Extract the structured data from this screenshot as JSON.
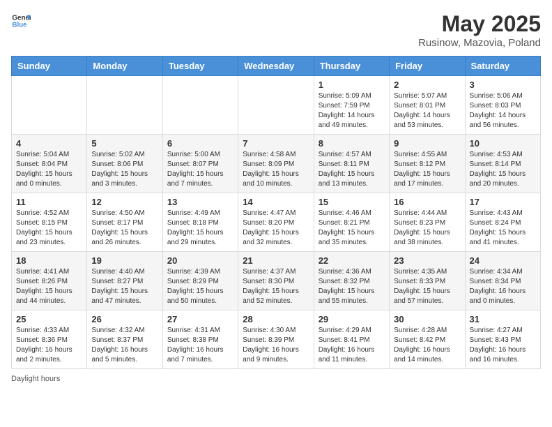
{
  "header": {
    "logo_general": "General",
    "logo_blue": "Blue",
    "title": "May 2025",
    "subtitle": "Rusinow, Mazovia, Poland"
  },
  "days_of_week": [
    "Sunday",
    "Monday",
    "Tuesday",
    "Wednesday",
    "Thursday",
    "Friday",
    "Saturday"
  ],
  "weeks": [
    [
      {
        "day": "",
        "info": ""
      },
      {
        "day": "",
        "info": ""
      },
      {
        "day": "",
        "info": ""
      },
      {
        "day": "",
        "info": ""
      },
      {
        "day": "1",
        "info": "Sunrise: 5:09 AM\nSunset: 7:59 PM\nDaylight: 14 hours\nand 49 minutes."
      },
      {
        "day": "2",
        "info": "Sunrise: 5:07 AM\nSunset: 8:01 PM\nDaylight: 14 hours\nand 53 minutes."
      },
      {
        "day": "3",
        "info": "Sunrise: 5:06 AM\nSunset: 8:03 PM\nDaylight: 14 hours\nand 56 minutes."
      }
    ],
    [
      {
        "day": "4",
        "info": "Sunrise: 5:04 AM\nSunset: 8:04 PM\nDaylight: 15 hours\nand 0 minutes."
      },
      {
        "day": "5",
        "info": "Sunrise: 5:02 AM\nSunset: 8:06 PM\nDaylight: 15 hours\nand 3 minutes."
      },
      {
        "day": "6",
        "info": "Sunrise: 5:00 AM\nSunset: 8:07 PM\nDaylight: 15 hours\nand 7 minutes."
      },
      {
        "day": "7",
        "info": "Sunrise: 4:58 AM\nSunset: 8:09 PM\nDaylight: 15 hours\nand 10 minutes."
      },
      {
        "day": "8",
        "info": "Sunrise: 4:57 AM\nSunset: 8:11 PM\nDaylight: 15 hours\nand 13 minutes."
      },
      {
        "day": "9",
        "info": "Sunrise: 4:55 AM\nSunset: 8:12 PM\nDaylight: 15 hours\nand 17 minutes."
      },
      {
        "day": "10",
        "info": "Sunrise: 4:53 AM\nSunset: 8:14 PM\nDaylight: 15 hours\nand 20 minutes."
      }
    ],
    [
      {
        "day": "11",
        "info": "Sunrise: 4:52 AM\nSunset: 8:15 PM\nDaylight: 15 hours\nand 23 minutes."
      },
      {
        "day": "12",
        "info": "Sunrise: 4:50 AM\nSunset: 8:17 PM\nDaylight: 15 hours\nand 26 minutes."
      },
      {
        "day": "13",
        "info": "Sunrise: 4:49 AM\nSunset: 8:18 PM\nDaylight: 15 hours\nand 29 minutes."
      },
      {
        "day": "14",
        "info": "Sunrise: 4:47 AM\nSunset: 8:20 PM\nDaylight: 15 hours\nand 32 minutes."
      },
      {
        "day": "15",
        "info": "Sunrise: 4:46 AM\nSunset: 8:21 PM\nDaylight: 15 hours\nand 35 minutes."
      },
      {
        "day": "16",
        "info": "Sunrise: 4:44 AM\nSunset: 8:23 PM\nDaylight: 15 hours\nand 38 minutes."
      },
      {
        "day": "17",
        "info": "Sunrise: 4:43 AM\nSunset: 8:24 PM\nDaylight: 15 hours\nand 41 minutes."
      }
    ],
    [
      {
        "day": "18",
        "info": "Sunrise: 4:41 AM\nSunset: 8:26 PM\nDaylight: 15 hours\nand 44 minutes."
      },
      {
        "day": "19",
        "info": "Sunrise: 4:40 AM\nSunset: 8:27 PM\nDaylight: 15 hours\nand 47 minutes."
      },
      {
        "day": "20",
        "info": "Sunrise: 4:39 AM\nSunset: 8:29 PM\nDaylight: 15 hours\nand 50 minutes."
      },
      {
        "day": "21",
        "info": "Sunrise: 4:37 AM\nSunset: 8:30 PM\nDaylight: 15 hours\nand 52 minutes."
      },
      {
        "day": "22",
        "info": "Sunrise: 4:36 AM\nSunset: 8:32 PM\nDaylight: 15 hours\nand 55 minutes."
      },
      {
        "day": "23",
        "info": "Sunrise: 4:35 AM\nSunset: 8:33 PM\nDaylight: 15 hours\nand 57 minutes."
      },
      {
        "day": "24",
        "info": "Sunrise: 4:34 AM\nSunset: 8:34 PM\nDaylight: 16 hours\nand 0 minutes."
      }
    ],
    [
      {
        "day": "25",
        "info": "Sunrise: 4:33 AM\nSunset: 8:36 PM\nDaylight: 16 hours\nand 2 minutes."
      },
      {
        "day": "26",
        "info": "Sunrise: 4:32 AM\nSunset: 8:37 PM\nDaylight: 16 hours\nand 5 minutes."
      },
      {
        "day": "27",
        "info": "Sunrise: 4:31 AM\nSunset: 8:38 PM\nDaylight: 16 hours\nand 7 minutes."
      },
      {
        "day": "28",
        "info": "Sunrise: 4:30 AM\nSunset: 8:39 PM\nDaylight: 16 hours\nand 9 minutes."
      },
      {
        "day": "29",
        "info": "Sunrise: 4:29 AM\nSunset: 8:41 PM\nDaylight: 16 hours\nand 11 minutes."
      },
      {
        "day": "30",
        "info": "Sunrise: 4:28 AM\nSunset: 8:42 PM\nDaylight: 16 hours\nand 14 minutes."
      },
      {
        "day": "31",
        "info": "Sunrise: 4:27 AM\nSunset: 8:43 PM\nDaylight: 16 hours\nand 16 minutes."
      }
    ]
  ],
  "footer": {
    "daylight_label": "Daylight hours"
  }
}
